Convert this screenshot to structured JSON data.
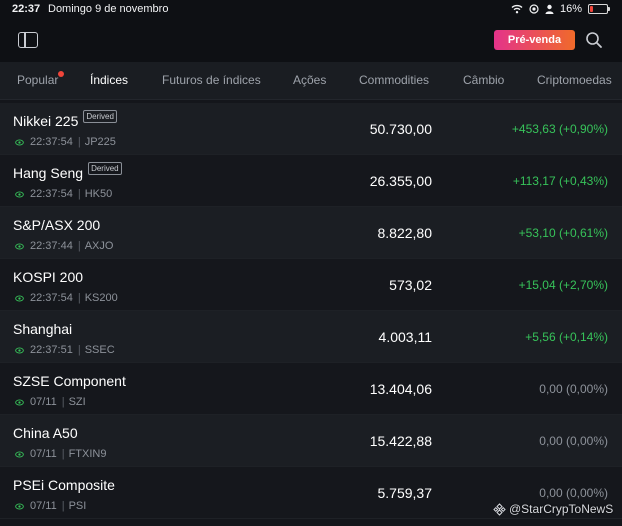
{
  "status_bar": {
    "time": "22:37",
    "date": "Domingo 9 de novembro",
    "battery": "16%"
  },
  "header": {
    "presale_label": "Pré-venda"
  },
  "tabs": [
    {
      "label": "Popular",
      "active": false,
      "has_dot": true
    },
    {
      "label": "Índices",
      "active": true
    },
    {
      "label": "Futuros de índices",
      "active": false
    },
    {
      "label": "Ações",
      "active": false
    },
    {
      "label": "Commodities",
      "active": false
    },
    {
      "label": "Câmbio",
      "active": false
    },
    {
      "label": "Criptomoedas",
      "active": false
    }
  ],
  "indices": [
    {
      "name": "Nikkei 225",
      "badge": "Derived",
      "time": "22:37:54",
      "symbol": "JP225",
      "price": "50.730,00",
      "change": "+453,63 (+0,90%)",
      "direction": "up"
    },
    {
      "name": "Hang Seng",
      "badge": "Derived",
      "time": "22:37:54",
      "symbol": "HK50",
      "price": "26.355,00",
      "change": "+113,17 (+0,43%)",
      "direction": "up"
    },
    {
      "name": "S&P/ASX 200",
      "badge": "",
      "time": "22:37:44",
      "symbol": "AXJO",
      "price": "8.822,80",
      "change": "+53,10 (+0,61%)",
      "direction": "up"
    },
    {
      "name": "KOSPI 200",
      "badge": "",
      "time": "22:37:54",
      "symbol": "KS200",
      "price": "573,02",
      "change": "+15,04 (+2,70%)",
      "direction": "up"
    },
    {
      "name": "Shanghai",
      "badge": "",
      "time": "22:37:51",
      "symbol": "SSEC",
      "price": "4.003,11",
      "change": "+5,56 (+0,14%)",
      "direction": "up"
    },
    {
      "name": "SZSE Component",
      "badge": "",
      "time": "07/11",
      "symbol": "SZI",
      "price": "13.404,06",
      "change": "0,00 (0,00%)",
      "direction": "flat"
    },
    {
      "name": "China A50",
      "badge": "",
      "time": "07/11",
      "symbol": "FTXIN9",
      "price": "15.422,88",
      "change": "0,00 (0,00%)",
      "direction": "flat"
    },
    {
      "name": "PSEi Composite",
      "badge": "",
      "time": "07/11",
      "symbol": "PSI",
      "price": "5.759,37",
      "change": "0,00 (0,00%)",
      "direction": "flat"
    }
  ],
  "watermark": "@StarCrypToNewS",
  "colors": {
    "up": "#37c35a",
    "flat": "#8d929a",
    "accent_start": "#e4338a",
    "accent_end": "#f06a2a",
    "background": "#14161b"
  }
}
